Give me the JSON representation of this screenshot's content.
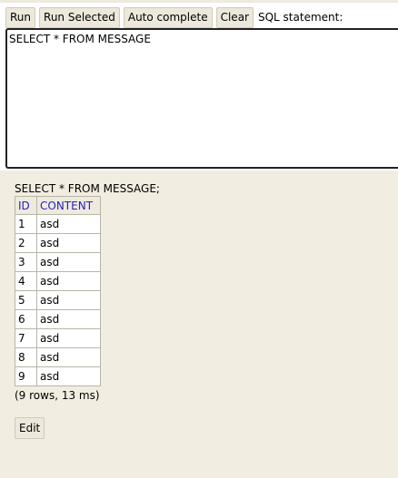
{
  "toolbar": {
    "run_label": "Run",
    "run_selected_label": "Run Selected",
    "autocomplete_label": "Auto complete",
    "clear_label": "Clear",
    "sql_statement_label": "SQL statement:"
  },
  "editor": {
    "value": "SELECT * FROM MESSAGE"
  },
  "result": {
    "query": "SELECT * FROM MESSAGE;",
    "columns": [
      "ID",
      "CONTENT"
    ],
    "rows": [
      [
        "1",
        "asd"
      ],
      [
        "2",
        "asd"
      ],
      [
        "3",
        "asd"
      ],
      [
        "4",
        "asd"
      ],
      [
        "5",
        "asd"
      ],
      [
        "6",
        "asd"
      ],
      [
        "7",
        "asd"
      ],
      [
        "8",
        "asd"
      ],
      [
        "9",
        "asd"
      ]
    ],
    "status": "(9 rows, 13 ms)",
    "edit_label": "Edit"
  },
  "colors": {
    "result_background": "#f1ede0",
    "header_text": "#2a22c0",
    "button_background": "#ece8dc"
  }
}
